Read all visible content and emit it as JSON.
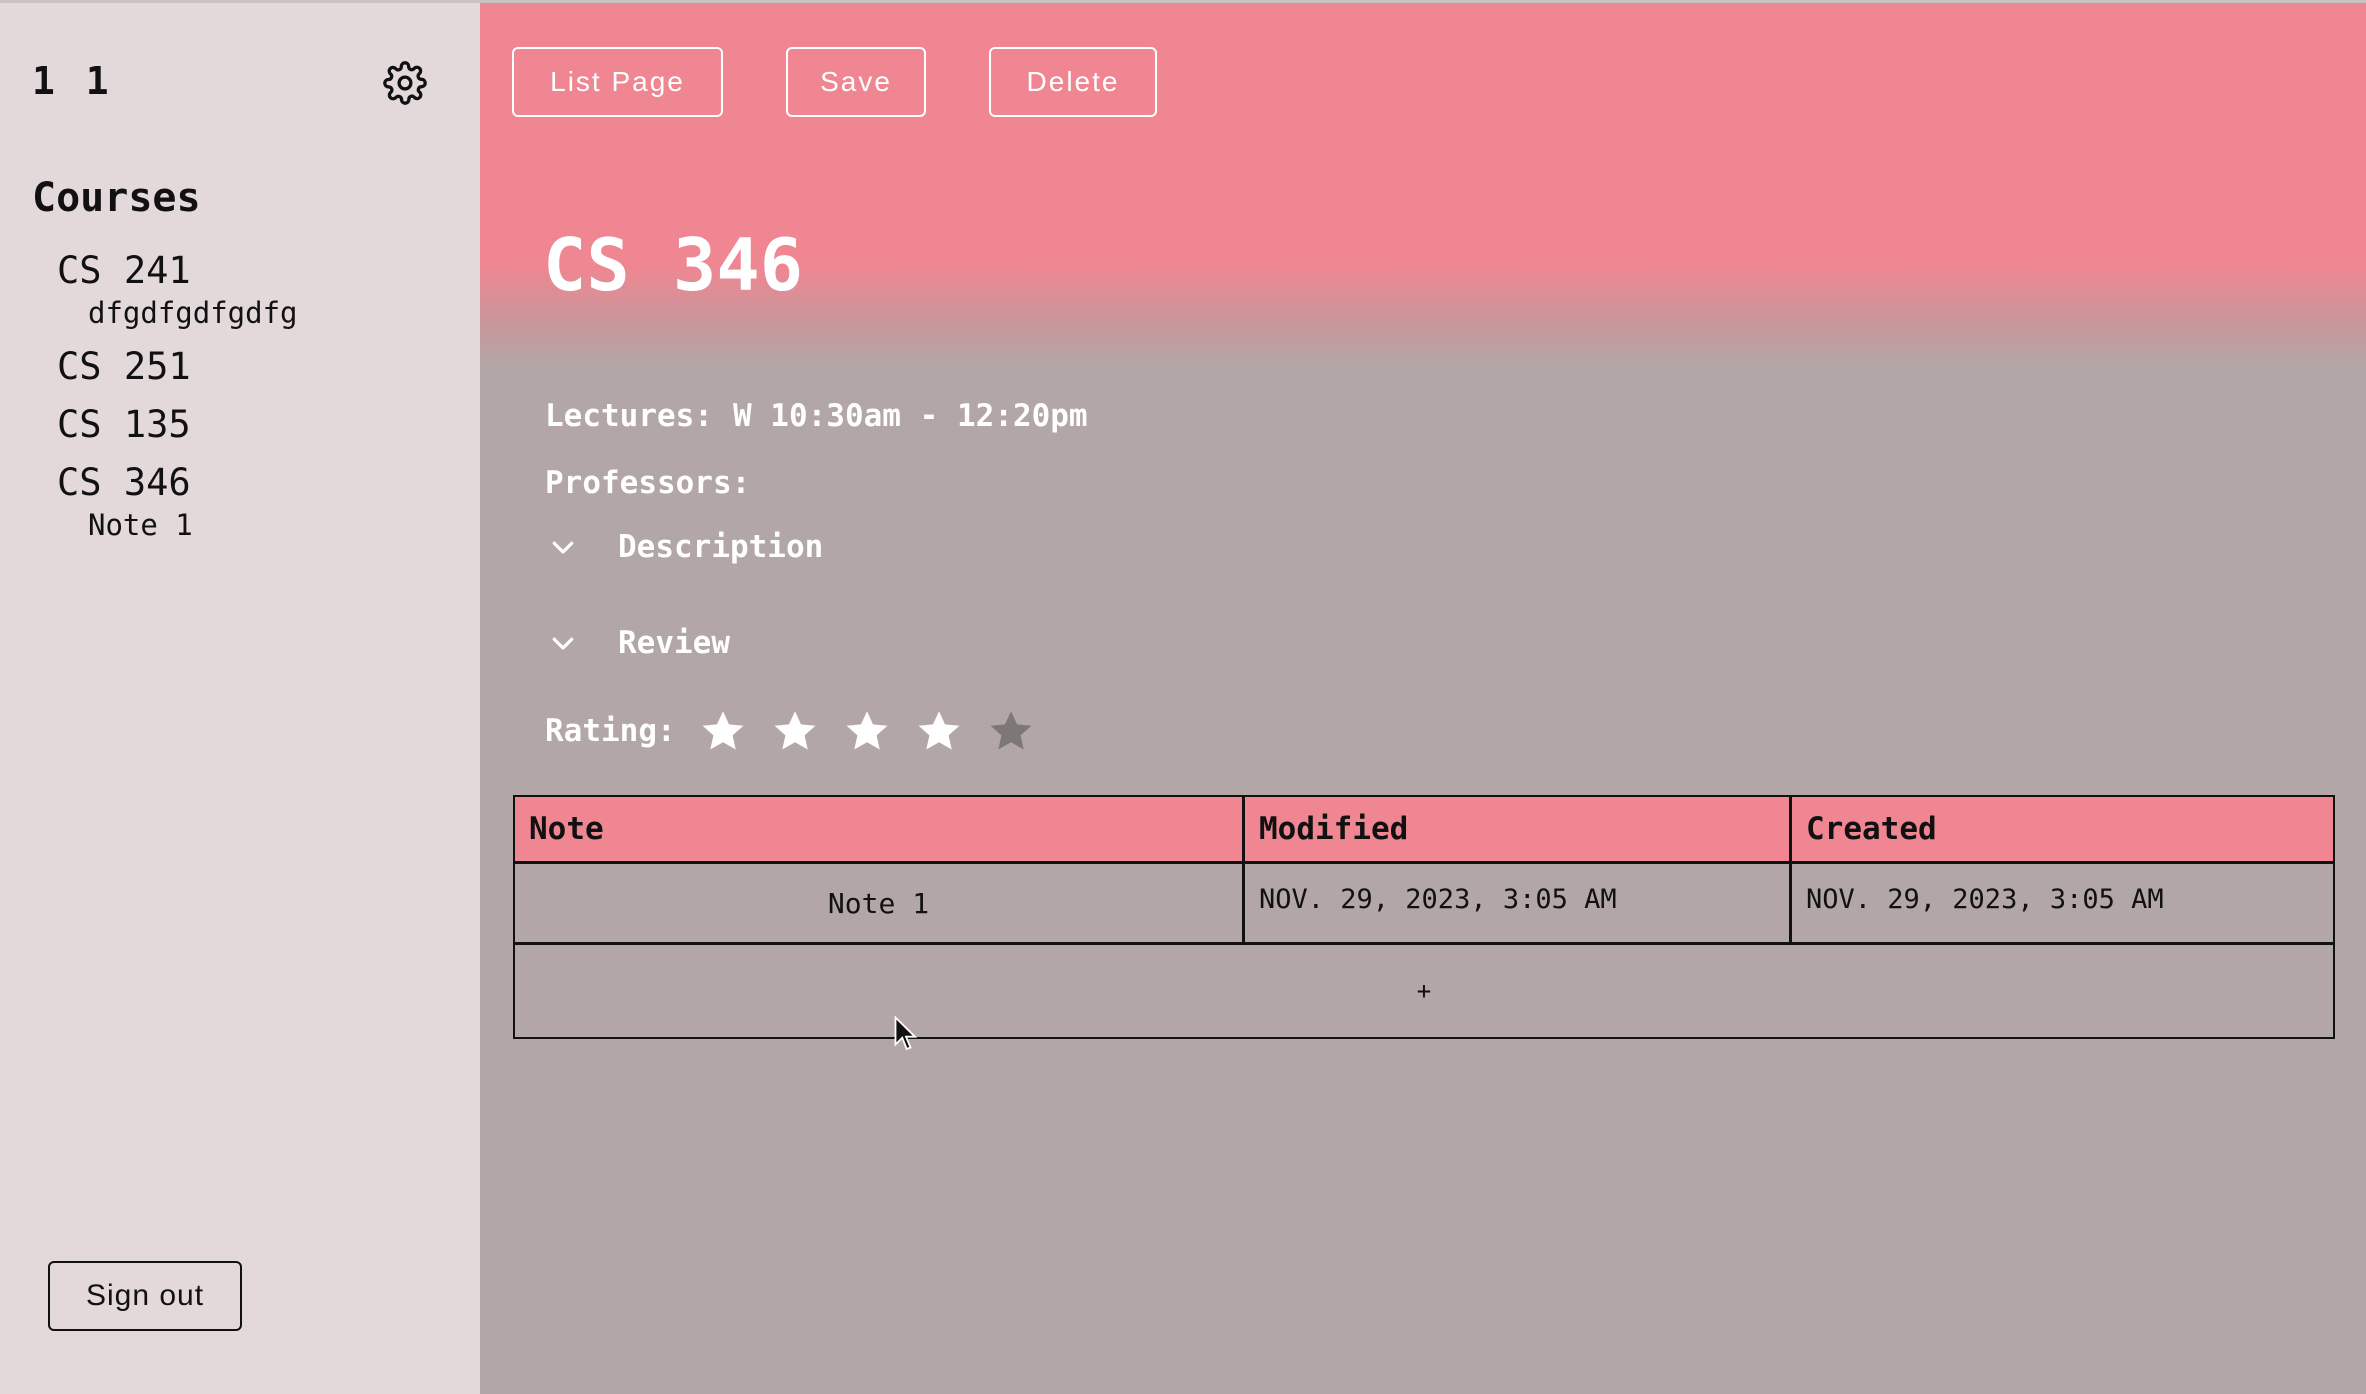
{
  "sidebar": {
    "user_name": "1 1",
    "courses_title": "Courses",
    "courses": [
      {
        "label": "CS 241",
        "notes": [
          "dfgdfgdfgdfg"
        ]
      },
      {
        "label": "CS 251",
        "notes": []
      },
      {
        "label": "CS 135",
        "notes": []
      },
      {
        "label": "CS 346",
        "notes": [
          "Note 1"
        ]
      }
    ],
    "sign_out_label": "Sign out",
    "settings_icon": "gear-icon"
  },
  "toolbar": {
    "list_page_label": "List Page",
    "save_label": "Save",
    "delete_label": "Delete"
  },
  "course": {
    "title": "CS 346",
    "lectures_label": "Lectures:",
    "lectures_value": "W 10:30am - 12:20pm",
    "professors_label": "Professors:",
    "description_label": "Description",
    "review_label": "Review",
    "rating_label": "Rating:",
    "rating": 4,
    "rating_max": 5
  },
  "notes_table": {
    "headers": [
      "Note",
      "Modified",
      "Created"
    ],
    "rows": [
      {
        "note": "Note 1",
        "modified": "NOV. 29, 2023, 3:05 AM",
        "created": "NOV. 29, 2023, 3:05 AM"
      }
    ],
    "add_label": "+"
  },
  "colors": {
    "accent": "#ef8692",
    "sidebar_bg": "#e3d9da",
    "main_bg": "#b2a7a6",
    "star_filled": "#ffffff",
    "star_empty": "#7d7777"
  }
}
